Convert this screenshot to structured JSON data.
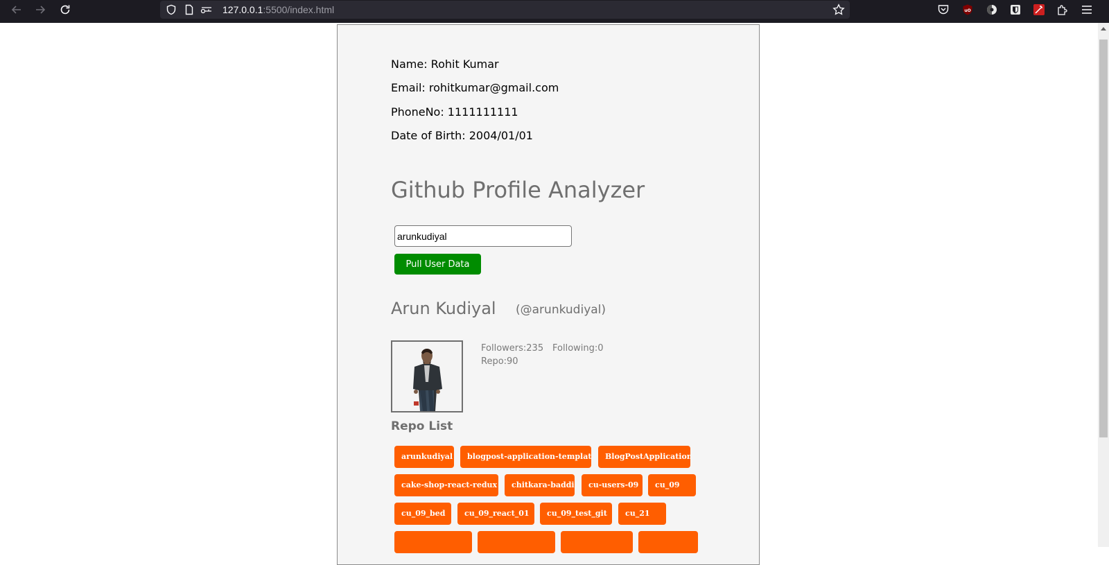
{
  "browser": {
    "url_host": "127.0.0.1",
    "url_path": ":5500/index.html"
  },
  "profile_info": {
    "name_line": "Name: Rohit Kumar",
    "email_line": "Email: rohitkumar@gmail.com",
    "phone_line": "PhoneNo: 1111111111",
    "dob_line": "Date of Birth: 2004/01/01"
  },
  "analyzer": {
    "title": "Github Profile Analyzer",
    "username_value": "arunkudiyal",
    "pull_button_label": "Pull User Data"
  },
  "github_user": {
    "name": "Arun Kudiyal",
    "handle": "(@arunkudiyal)",
    "followers": "Followers:235",
    "following": "Following:0",
    "repos": "Repo:90"
  },
  "repo_list": {
    "title": "Repo List",
    "repos": [
      "arunkudiyal",
      "blogpost-application-template",
      "BlogPostApplication",
      "cake-shop-react-redux",
      "chitkara-baddi",
      "cu-users-09",
      "cu_09",
      "cu_09_bed",
      "cu_09_react_01",
      "cu_09_test_git",
      "cu_21"
    ]
  },
  "colors": {
    "pull_button": "#008c00",
    "repo_tag": "#ff5e00",
    "card_background": "#f5f5f5",
    "muted_text": "#6f6f6f"
  },
  "icons": {
    "toolbar": [
      "back-arrow-icon",
      "forward-arrow-icon",
      "reload-icon",
      "shield-icon",
      "page-icon",
      "permissions-icon",
      "bookmark-star-icon"
    ],
    "extensions": [
      "pocket-icon",
      "ublock-icon",
      "privacy-badger-icon",
      "bitwarden-icon",
      "wand-extension-icon",
      "extensions-puzzle-icon",
      "menu-hamburger-icon"
    ]
  }
}
